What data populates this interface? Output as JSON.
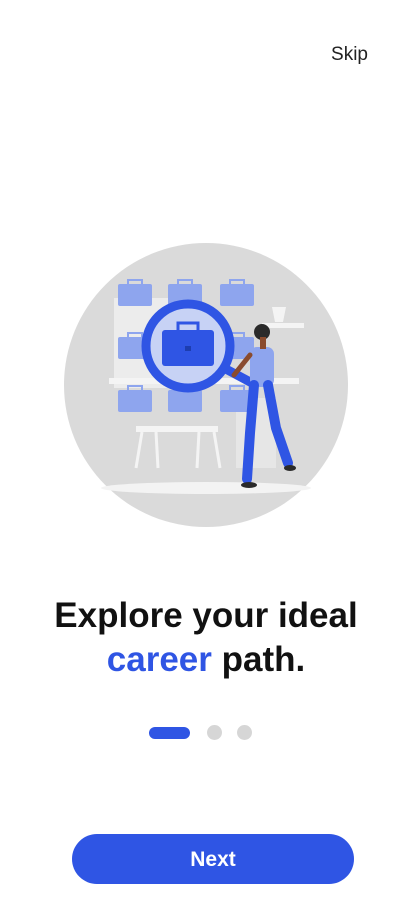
{
  "header": {
    "skip_label": "Skip"
  },
  "onboarding": {
    "title_line1": "Explore your ideal",
    "title_accent": "career",
    "title_rest": " path.",
    "page_indicator": {
      "current": 1,
      "total": 3
    }
  },
  "footer": {
    "next_label": "Next"
  },
  "colors": {
    "accent": "#2f55e4",
    "dot_inactive": "#d6d6d6",
    "illustration_bg": "#dadada"
  },
  "illustration": {
    "icon": "job-search-magnifier-illustration"
  }
}
